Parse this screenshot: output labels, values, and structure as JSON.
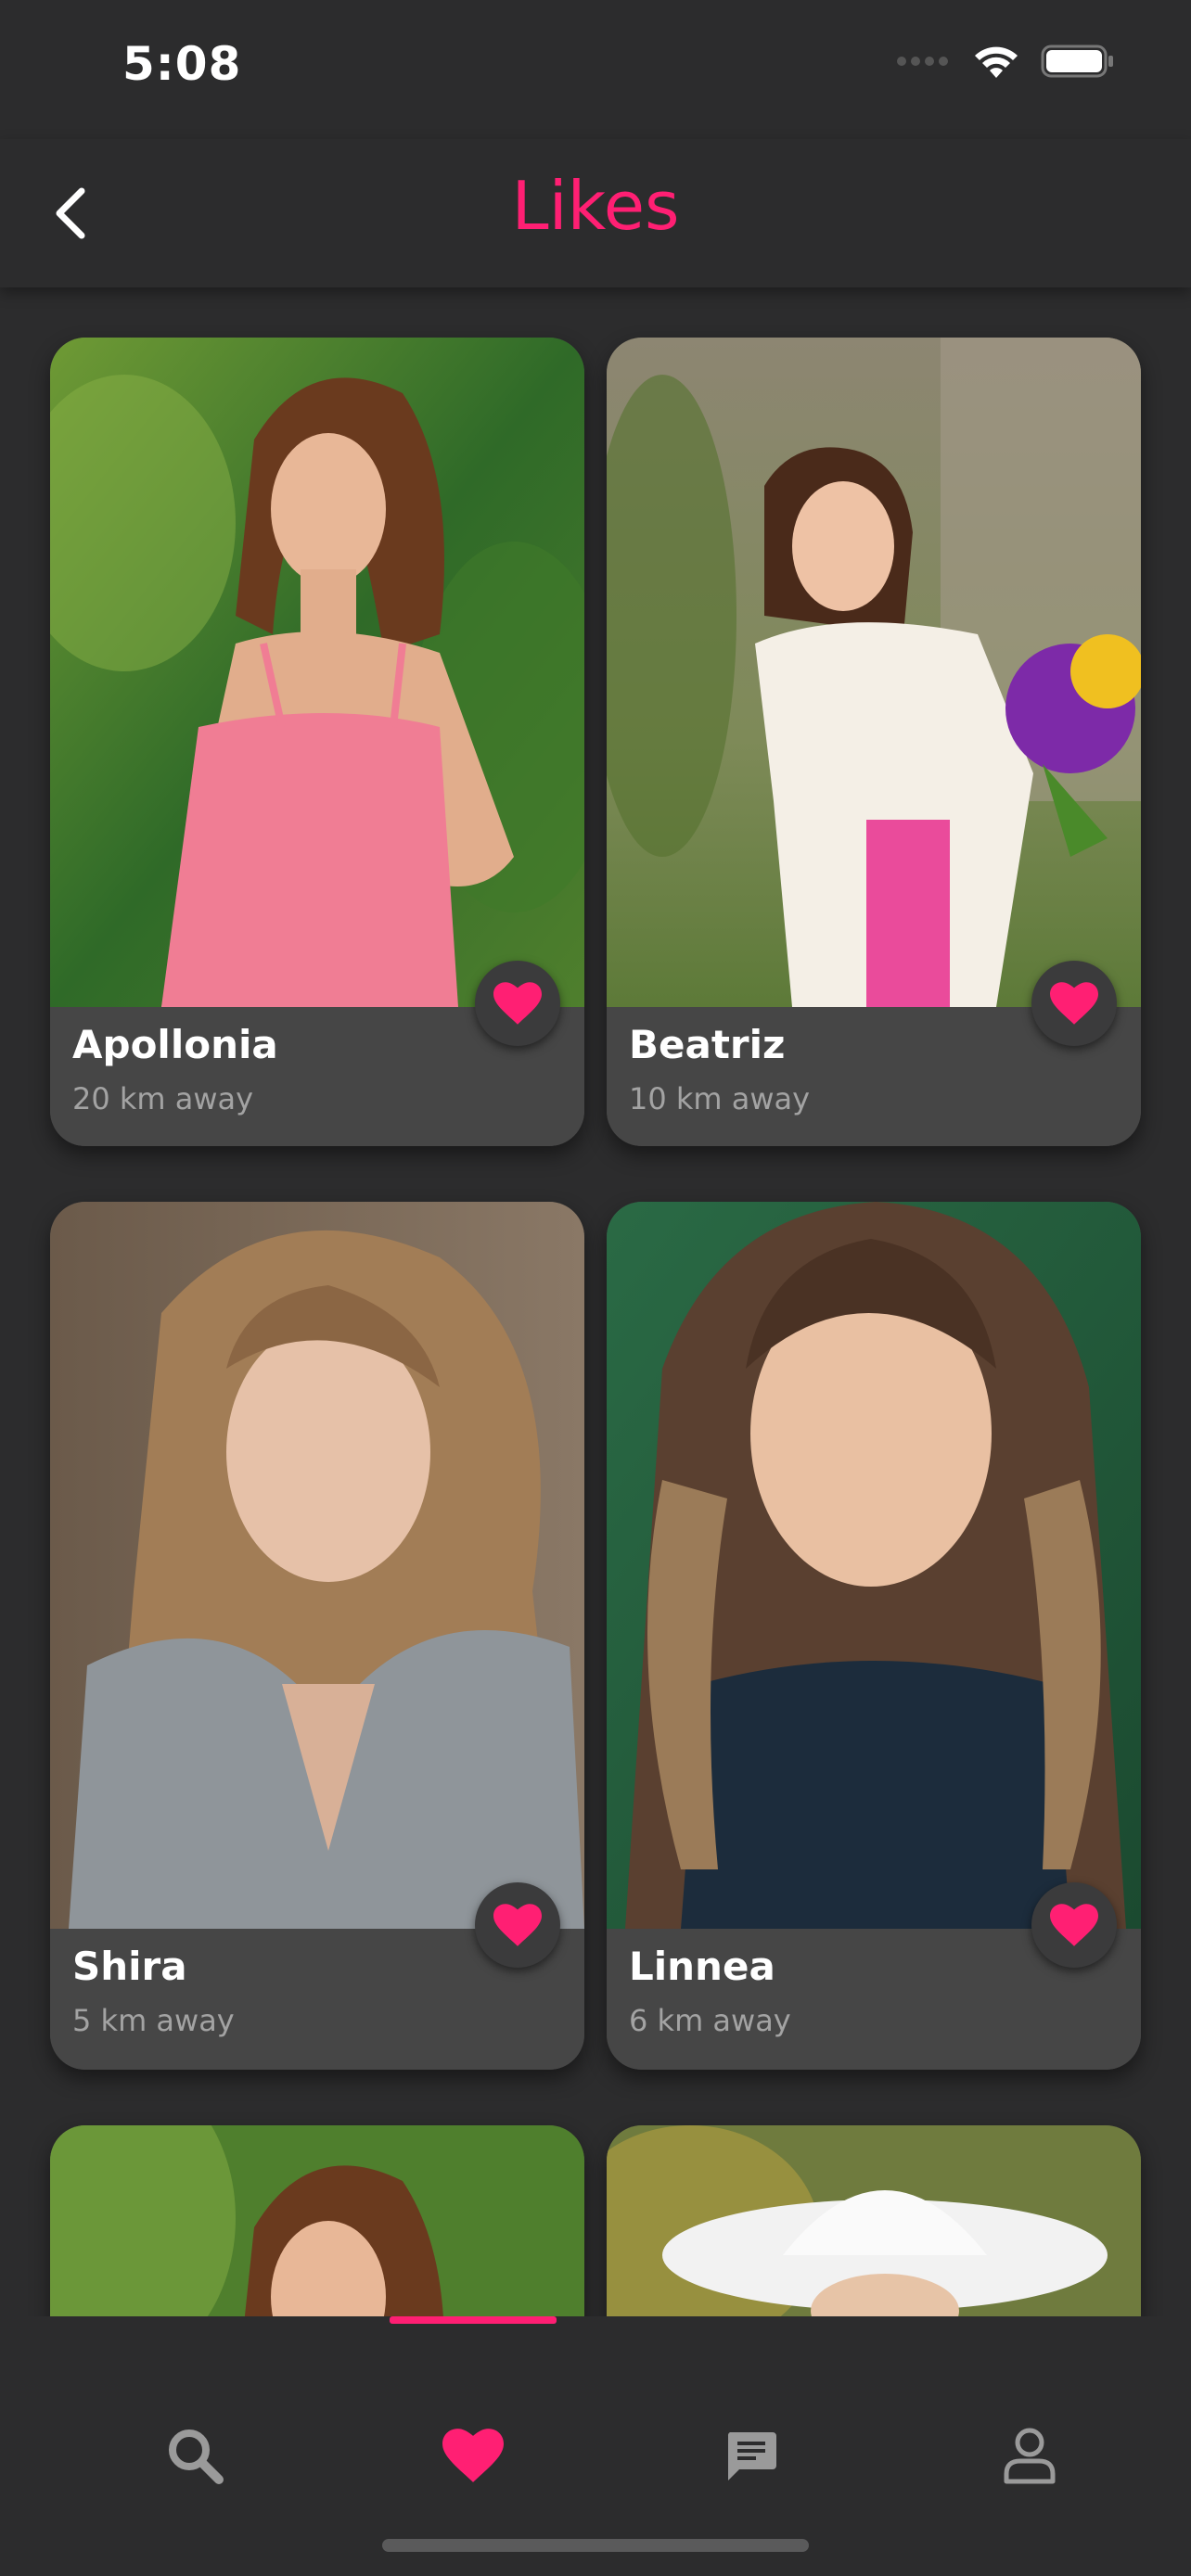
{
  "status_bar": {
    "time": "5:08"
  },
  "header": {
    "title": "Likes"
  },
  "colors": {
    "accent": "#ff1f73",
    "background": "#2c2c2d",
    "card": "#464646",
    "muted_text": "#a3a3a3"
  },
  "profiles": [
    {
      "name": "Apollonia",
      "distance": "20 km away",
      "liked": true
    },
    {
      "name": "Beatriz",
      "distance": "10 km away",
      "liked": true
    },
    {
      "name": "Shira",
      "distance": "5 km away",
      "liked": true
    },
    {
      "name": "Linnea",
      "distance": "6 km away",
      "liked": true
    },
    {
      "name": "",
      "distance": "",
      "liked": true
    },
    {
      "name": "",
      "distance": "",
      "liked": true
    }
  ],
  "tab_bar": {
    "active": "likes",
    "items": [
      {
        "id": "search",
        "icon": "search-icon"
      },
      {
        "id": "likes",
        "icon": "heart-icon"
      },
      {
        "id": "messages",
        "icon": "chat-icon"
      },
      {
        "id": "profile",
        "icon": "user-icon"
      }
    ]
  }
}
